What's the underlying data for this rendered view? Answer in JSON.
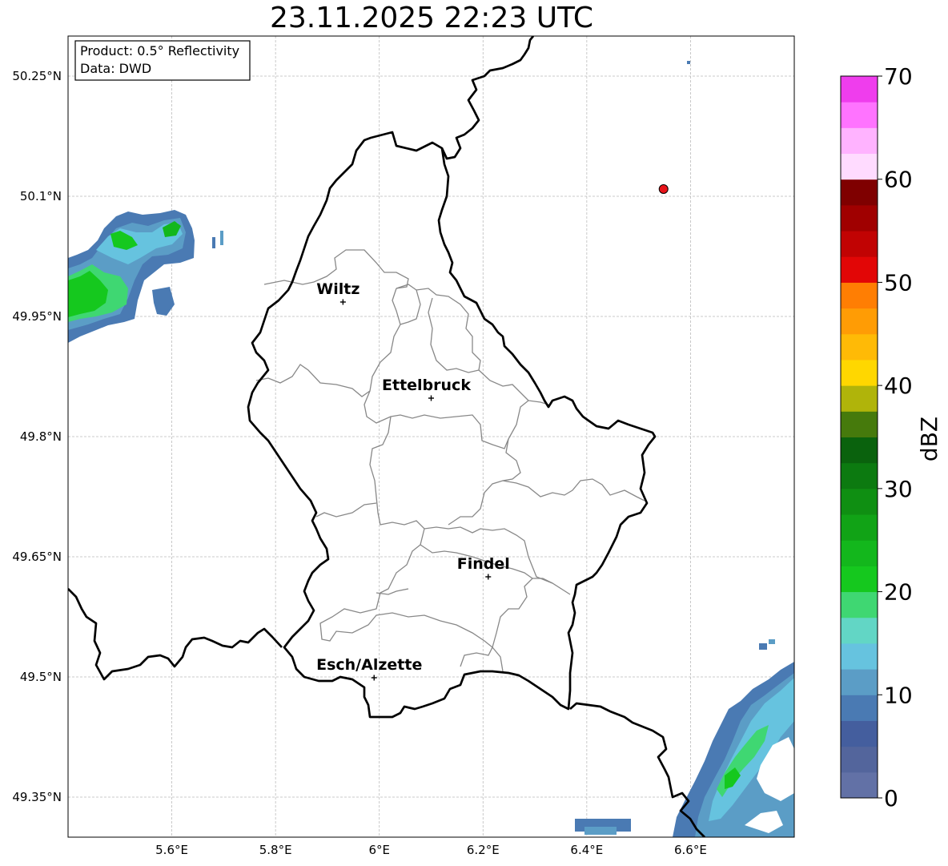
{
  "title": "23.11.2025 22:23 UTC",
  "info": {
    "product": "Product: 0.5° Reflectivity",
    "data": "Data: DWD"
  },
  "map": {
    "lon_range": [
      5.4,
      6.8
    ],
    "lat_range": [
      49.3,
      50.3
    ],
    "lon_ticks": [
      {
        "value": 5.6,
        "label": "5.6°E"
      },
      {
        "value": 5.8,
        "label": "5.8°E"
      },
      {
        "value": 6.0,
        "label": "6°E"
      },
      {
        "value": 6.2,
        "label": "6.2°E"
      },
      {
        "value": 6.4,
        "label": "6.4°E"
      },
      {
        "value": 6.6,
        "label": "6.6°E"
      }
    ],
    "lat_ticks": [
      {
        "value": 50.25,
        "label": "50.25°N"
      },
      {
        "value": 50.1,
        "label": "50.1°N"
      },
      {
        "value": 49.95,
        "label": "49.95°N"
      },
      {
        "value": 49.8,
        "label": "49.8°N"
      },
      {
        "value": 49.65,
        "label": "49.65°N"
      },
      {
        "value": 49.5,
        "label": "49.5°N"
      },
      {
        "value": 49.35,
        "label": "49.35°N"
      }
    ],
    "cities": [
      {
        "name": "Wiltz",
        "lon": 5.93,
        "lat": 49.968
      },
      {
        "name": "Ettelbruck",
        "lon": 6.1,
        "lat": 49.848
      },
      {
        "name": "Findel",
        "lon": 6.21,
        "lat": 49.625
      },
      {
        "name": "Esch/Alzette",
        "lon": 5.99,
        "lat": 49.499
      }
    ],
    "radar_marker": {
      "lon": 6.548,
      "lat": 50.109,
      "color": "#e8141a"
    }
  },
  "colorbar": {
    "label": "dBZ",
    "min": 0,
    "max": 70,
    "ticks": [
      "0",
      "10",
      "20",
      "30",
      "40",
      "50",
      "60",
      "70"
    ],
    "colors": [
      "#6271a6",
      "#53659c",
      "#445e9e",
      "#4a7ab3",
      "#5b9dc6",
      "#66c3df",
      "#62d6c5",
      "#3fd772",
      "#15c81e",
      "#13b71c",
      "#11a316",
      "#0f8f12",
      "#0c7a10",
      "#0a620d",
      "#467a0c",
      "#b0b40a",
      "#ffd700",
      "#ffba06",
      "#ff9c05",
      "#ff7e03",
      "#e20606",
      "#c10303",
      "#a00000",
      "#7f0000",
      "#ffdbff",
      "#ffb3ff",
      "#ff73ff",
      "#ef3ded"
    ]
  }
}
